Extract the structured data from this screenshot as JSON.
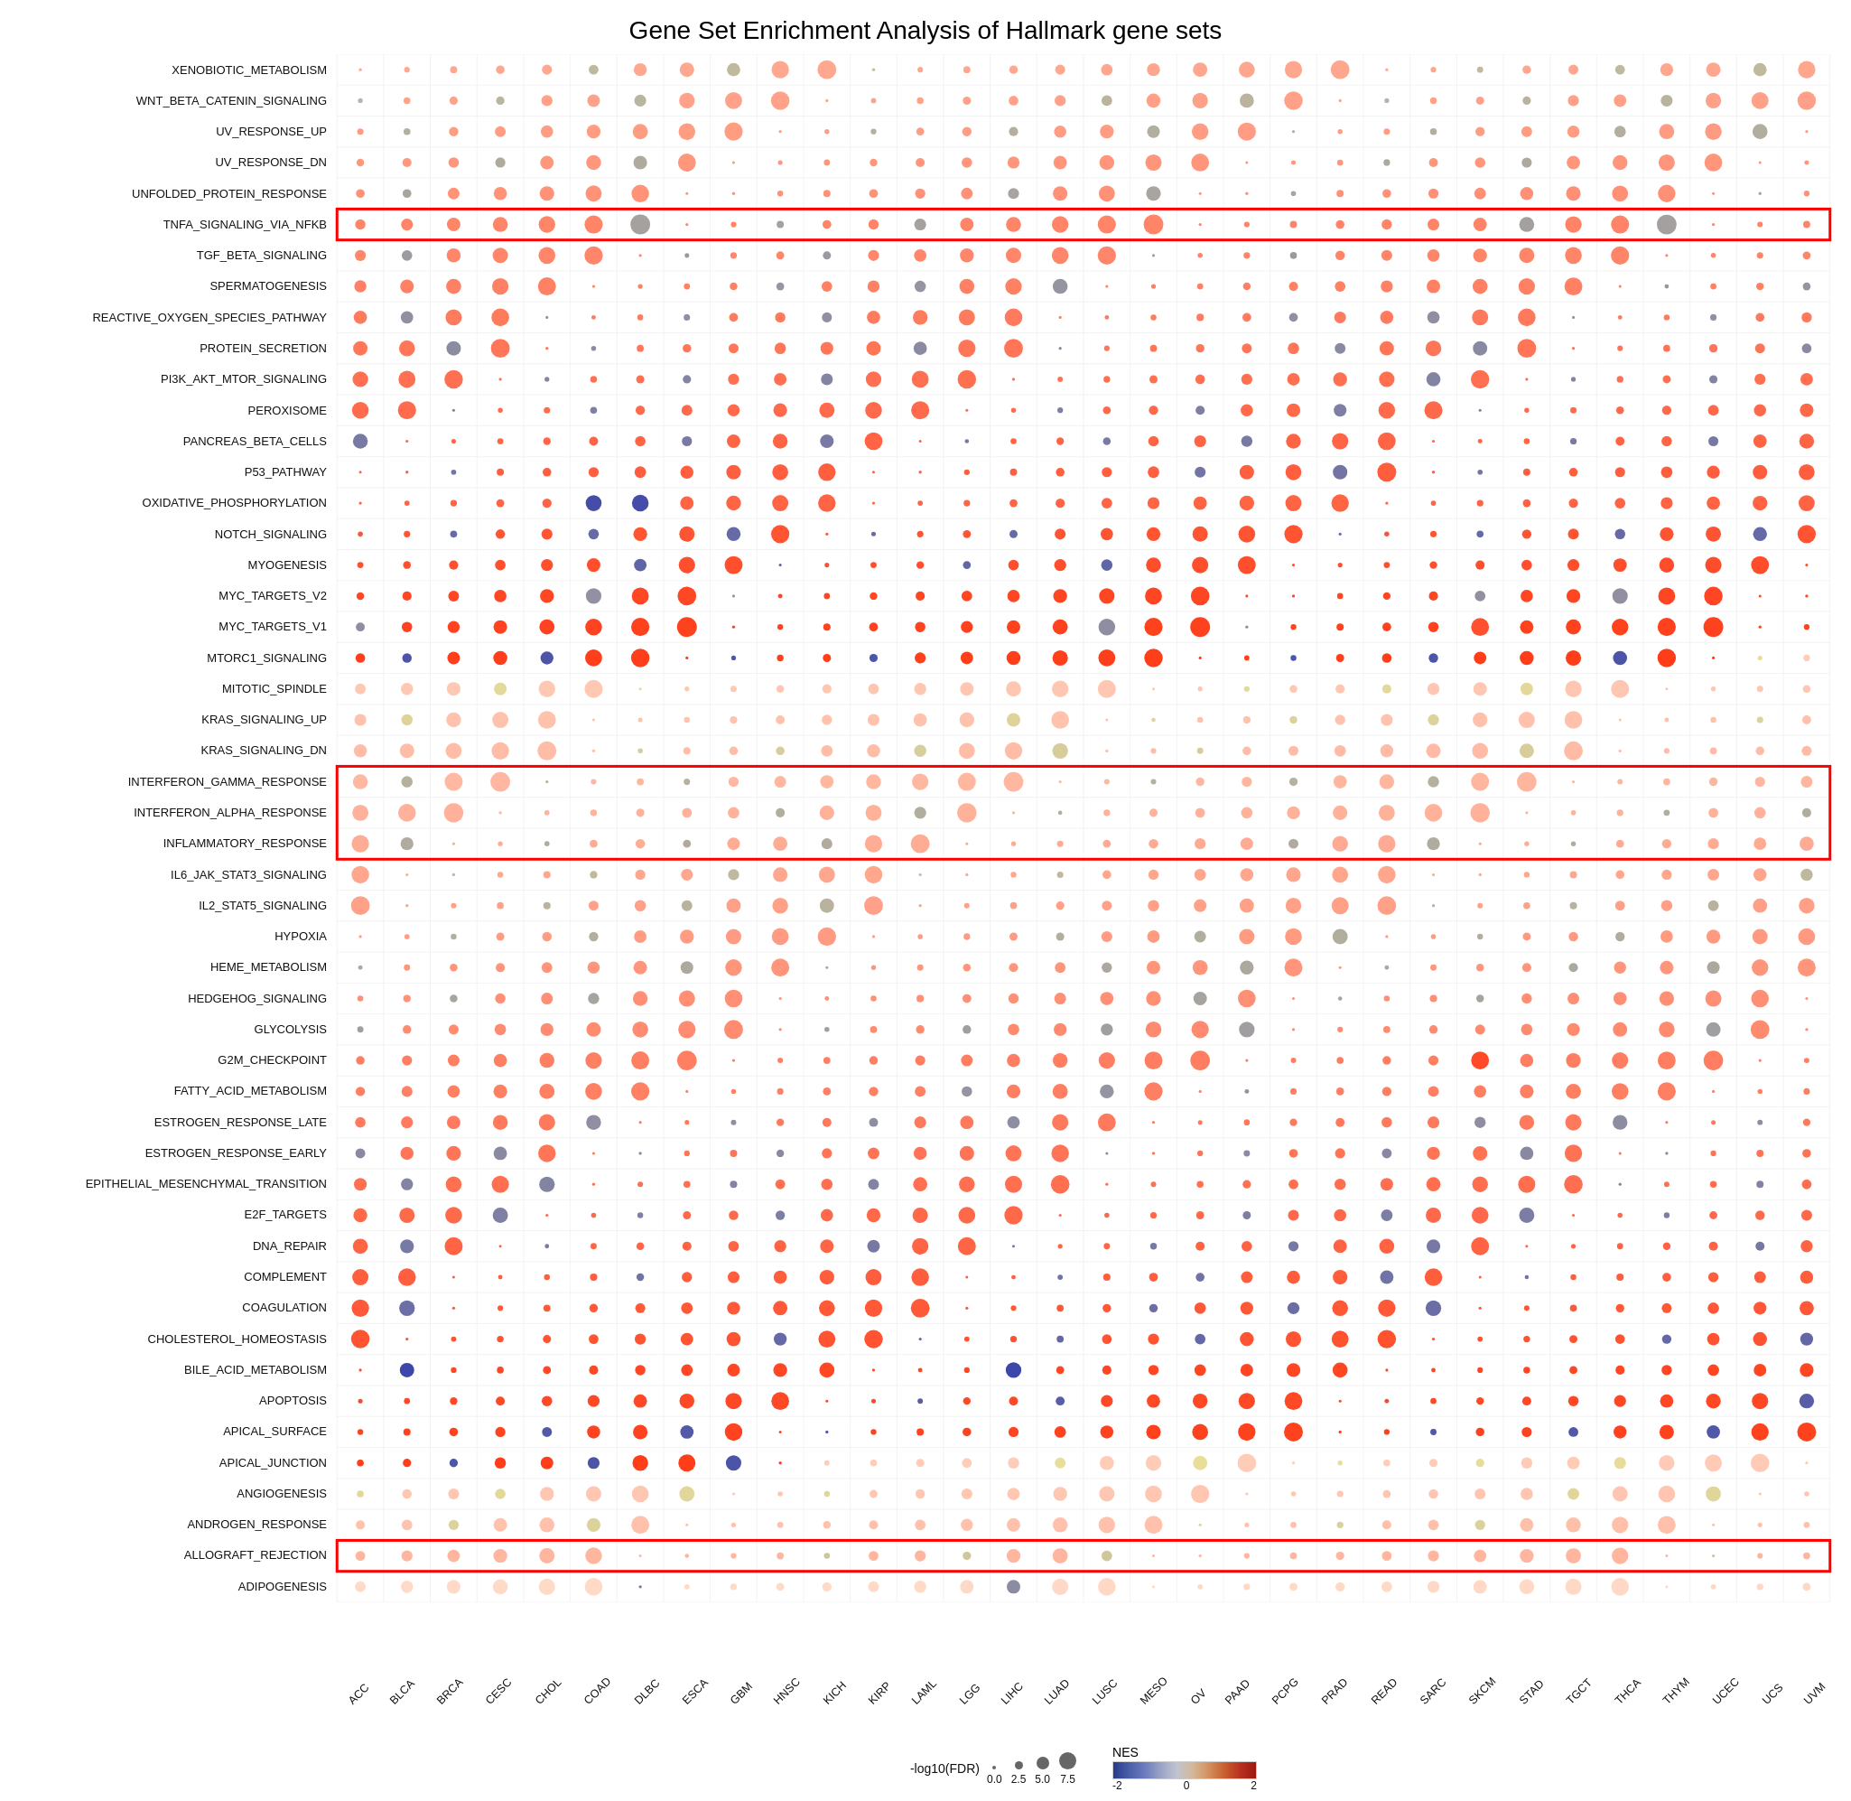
{
  "title": "Gene Set Enrichment Analysis of Hallmark gene sets",
  "yLabels": [
    "XENOBIOTIC_METABOLISM",
    "WNT_BETA_CATENIN_SIGNALING",
    "UV_RESPONSE_UP",
    "UV_RESPONSE_DN",
    "UNFOLDED_PROTEIN_RESPONSE",
    "TNFA_SIGNALING_VIA_NFKB",
    "TGF_BETA_SIGNALING",
    "SPERMATOGENESIS",
    "REACTIVE_OXYGEN_SPECIES_PATHWAY",
    "PROTEIN_SECRETION",
    "PI3K_AKT_MTOR_SIGNALING",
    "PEROXISOME",
    "PANCREAS_BETA_CELLS",
    "P53_PATHWAY",
    "OXIDATIVE_PHOSPHORYLATION",
    "NOTCH_SIGNALING",
    "MYOGENESIS",
    "MYC_TARGETS_V2",
    "MYC_TARGETS_V1",
    "MTORC1_SIGNALING",
    "MITOTIC_SPINDLE",
    "KRAS_SIGNALING_UP",
    "KRAS_SIGNALING_DN",
    "INTERFERON_GAMMA_RESPONSE",
    "INTERFERON_ALPHA_RESPONSE",
    "INFLAMMATORY_RESPONSE",
    "IL6_JAK_STAT3_SIGNALING",
    "IL2_STAT5_SIGNALING",
    "HYPOXIA",
    "HEME_METABOLISM",
    "HEDGEHOG_SIGNALING",
    "GLYCOLYSIS",
    "G2M_CHECKPOINT",
    "FATTY_ACID_METABOLISM",
    "ESTROGEN_RESPONSE_LATE",
    "ESTROGEN_RESPONSE_EARLY",
    "EPITHELIAL_MESENCHYMAL_TRANSITION",
    "E2F_TARGETS",
    "DNA_REPAIR",
    "COMPLEMENT",
    "COAGULATION",
    "CHOLESTEROL_HOMEOSTASIS",
    "BILE_ACID_METABOLISM",
    "APOPTOSIS",
    "APICAL_SURFACE",
    "APICAL_JUNCTION",
    "ANGIOGENESIS",
    "ANDROGEN_RESPONSE",
    "ALLOGRAFT_REJECTION",
    "ADIPOGENESIS"
  ],
  "xLabels": [
    "ACC",
    "BLCA",
    "BRCA",
    "CESC",
    "CHOL",
    "COAD",
    "DLBC",
    "ESCA",
    "GBM",
    "HNSC",
    "KICH",
    "KIRP",
    "LAML",
    "LGG",
    "LIHC",
    "LUAD",
    "LUSC",
    "MESO",
    "OV",
    "PAAD",
    "PCPG",
    "PRAD",
    "READ",
    "SARC",
    "SKCM",
    "STAD",
    "TGCT",
    "THCA",
    "THYM",
    "UCEC",
    "UCS",
    "UVM"
  ],
  "legend": {
    "sizeTitle": "-log10(FDR)",
    "sizeItems": [
      {
        "label": "0.0",
        "size": 4
      },
      {
        "label": "2.5",
        "size": 9
      },
      {
        "label": "5.0",
        "size": 14
      },
      {
        "label": "7.5",
        "size": 19
      }
    ],
    "nesTitle": "NES",
    "nesMin": "-2",
    "nesMid": "0",
    "nesMax": "2"
  },
  "redBoxRows": [
    5,
    23,
    24,
    25,
    48
  ],
  "colors": {
    "accent": "red"
  }
}
